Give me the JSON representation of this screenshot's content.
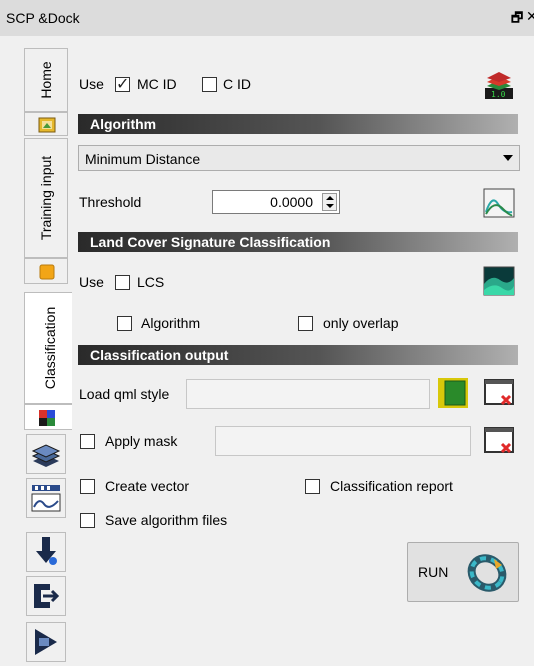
{
  "window": {
    "title": "SCP &Dock",
    "float_icon": "float-icon",
    "close_icon": "close-icon"
  },
  "tabs": [
    {
      "label": "Home",
      "icon": "home-icon"
    },
    {
      "label": "Training input",
      "icon": "training-icon"
    },
    {
      "label": "Classification",
      "icon": "classification-icon",
      "active": true
    }
  ],
  "side_icons": [
    "band-set-icon",
    "spectral-plot-icon",
    "download-icon",
    "export-icon",
    "postprocessing-icon"
  ],
  "use_row": {
    "label": "Use",
    "mc_id": {
      "label": "MC ID",
      "checked": true
    },
    "c_id": {
      "label": "C ID",
      "checked": false
    }
  },
  "algorithm": {
    "header": "Algorithm",
    "selected": "Minimum Distance",
    "threshold_label": "Threshold",
    "threshold_value": "0.0000"
  },
  "lcs": {
    "header": "Land Cover Signature Classification",
    "use_label": "Use",
    "lcs_label": "LCS",
    "algorithm_label": "Algorithm",
    "only_overlap_label": "only overlap"
  },
  "output": {
    "header": "Classification output",
    "load_qml_label": "Load qml style",
    "load_qml_value": "",
    "apply_mask_label": "Apply mask",
    "apply_mask_value": "",
    "create_vector_label": "Create vector",
    "classification_report_label": "Classification report",
    "save_algorithm_files_label": "Save algorithm files",
    "run_label": "RUN"
  },
  "colors": {
    "section_dark": "#2a2a2a",
    "panel_bg": "#f0f0f0",
    "titlebar_bg": "#dcdcdc"
  }
}
